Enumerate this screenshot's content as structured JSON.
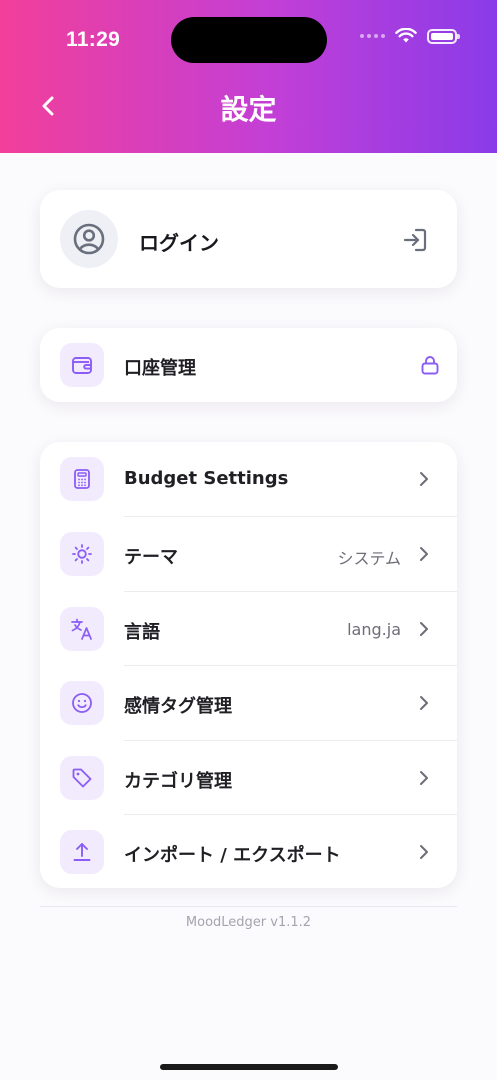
{
  "status_bar": {
    "time": "11:29"
  },
  "header": {
    "title": "設定",
    "back_icon": "chevron-left-icon"
  },
  "login": {
    "label": "ログイン",
    "avatar_icon": "user-circle-icon",
    "action_icon": "login-arrow-icon"
  },
  "account": {
    "label": "口座管理",
    "icon": "wallet-icon",
    "lock_icon": "lock-icon"
  },
  "settings": {
    "items": [
      {
        "label": "Budget Settings",
        "value": "",
        "icon": "calculator-icon"
      },
      {
        "label": "テーマ",
        "value": "システム",
        "icon": "sun-icon"
      },
      {
        "label": "言語",
        "value": "lang.ja",
        "icon": "translate-icon"
      },
      {
        "label": "感情タグ管理",
        "value": "",
        "icon": "smiley-icon"
      },
      {
        "label": "カテゴリ管理",
        "value": "",
        "icon": "tag-icon"
      },
      {
        "label": "インポート / エクスポート",
        "value": "",
        "icon": "upload-icon"
      }
    ]
  },
  "footer": {
    "version": "MoodLedger v1.1.2"
  },
  "colors": {
    "accent": "#8b5cf6",
    "gradient_start": "#f23f9a",
    "gradient_end": "#8a3be9"
  }
}
